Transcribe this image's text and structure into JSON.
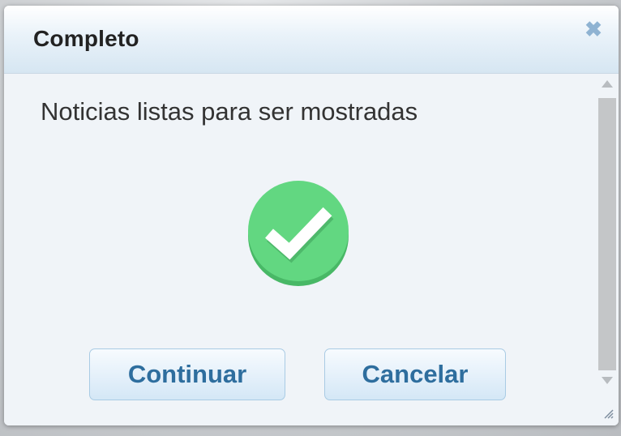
{
  "dialog": {
    "title": "Completo",
    "close_icon": "close-icon",
    "message": "Noticias listas para ser mostradas",
    "status_icon": "checkmark-success-icon",
    "buttons": {
      "continue_label": "Continuar",
      "cancel_label": "Cancelar"
    }
  },
  "colors": {
    "success_green": "#5fd67f",
    "button_text": "#2e6e9e",
    "close_icon": "#8fb3d2",
    "title_text": "#222222"
  }
}
